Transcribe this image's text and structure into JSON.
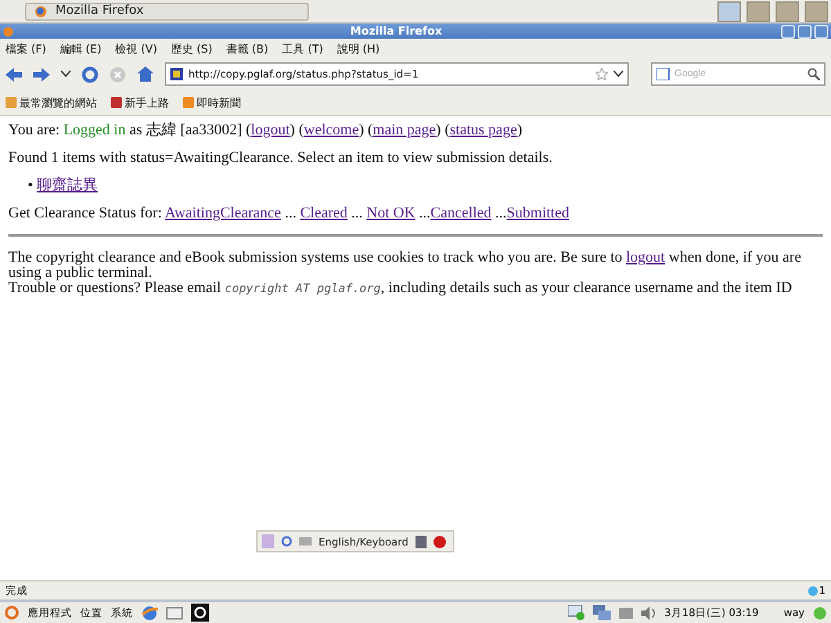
{
  "top_panel": {
    "window_button": "Mozilla Firefox"
  },
  "window": {
    "title": "Mozilla Firefox"
  },
  "menu": [
    "檔案 (F)",
    "編輯 (E)",
    "檢視 (V)",
    "歷史 (S)",
    "書籤 (B)",
    "工具 (T)",
    "說明 (H)"
  ],
  "nav": {
    "url": "http://copy.pglaf.org/status.php?status_id=1",
    "search_placeholder": "Google"
  },
  "bookmarks": [
    "最常瀏覽的網站",
    "新手上路",
    "即時新聞"
  ],
  "page": {
    "login_line": [
      {
        "kind": "text",
        "text": "You are: "
      },
      {
        "kind": "status",
        "text": "Logged in"
      },
      {
        "kind": "text",
        "text": " as 志緯 [aa33002] ("
      },
      {
        "kind": "link",
        "text": "logout"
      },
      {
        "kind": "text",
        "text": ") ("
      },
      {
        "kind": "link",
        "text": "welcome"
      },
      {
        "kind": "text",
        "text": ") ("
      },
      {
        "kind": "link",
        "text": "main page"
      },
      {
        "kind": "text",
        "text": ") ("
      },
      {
        "kind": "link",
        "text": "status page"
      },
      {
        "kind": "text",
        "text": ")"
      }
    ],
    "found_text": "Found 1 items with status=AwaitingClearance. Select an item to view submission details.",
    "items": [
      {
        "marker": "•",
        "title": "聊齋誌異"
      }
    ],
    "status_line": [
      {
        "kind": "text",
        "text": "Get Clearance Status for: "
      },
      {
        "kind": "link",
        "text": "AwaitingClearance"
      },
      {
        "kind": "text",
        "text": " ... "
      },
      {
        "kind": "link",
        "text": "Cleared"
      },
      {
        "kind": "text",
        "text": " ... "
      },
      {
        "kind": "link",
        "text": "Not OK"
      },
      {
        "kind": "text",
        "text": " ..."
      },
      {
        "kind": "link",
        "text": "Cancelled"
      },
      {
        "kind": "text",
        "text": " ..."
      },
      {
        "kind": "link",
        "text": "Submitted"
      }
    ],
    "notice": [
      {
        "kind": "text",
        "text": "The copyright clearance and eBook submission systems use cookies to track who you are. Be sure to "
      },
      {
        "kind": "link",
        "text": "logout"
      },
      {
        "kind": "text",
        "text": " when done, if you are using a public terminal."
      }
    ],
    "contact": [
      {
        "kind": "text",
        "text": "Trouble or questions? Please email "
      },
      {
        "kind": "email",
        "text": "copyright AT pglaf.org"
      },
      {
        "kind": "text",
        "text": ", including details such as your clearance username and the item ID"
      }
    ]
  },
  "ime_bar": {
    "label": "English/Keyboard"
  },
  "status_bar": {
    "text": "完成",
    "count": "1"
  },
  "bottom_panel": {
    "menus": [
      "應用程式",
      "位置",
      "系統"
    ],
    "clock": "3月18日(三) 03:19",
    "user": "way"
  }
}
